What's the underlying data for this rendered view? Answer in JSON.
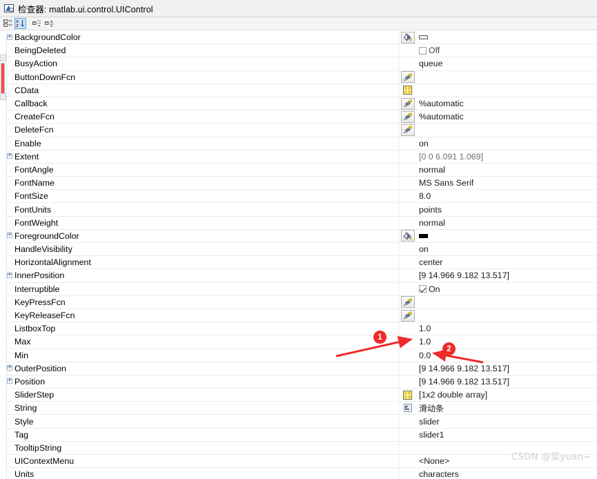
{
  "window": {
    "icon": "inspector-icon",
    "title": "检查器:  matlab.ui.control.UIControl"
  },
  "toolbar": {
    "buttons": [
      {
        "name": "sort-by-category-button",
        "label": "Sort by category",
        "active": false
      },
      {
        "name": "sort-alphabetically-button",
        "label": "Sort alphabetically",
        "active": true
      },
      {
        "name": "expand-all-button",
        "label": "Expand all",
        "active": false
      },
      {
        "name": "collapse-all-button",
        "label": "Collapse all",
        "active": false
      }
    ]
  },
  "grid": {
    "rows": [
      {
        "name": "BackgroundColor",
        "expandable": true,
        "value": "",
        "widget": "color",
        "editor": "paint-bucket",
        "swatch": "#f0f0f0"
      },
      {
        "name": "BeingDeleted",
        "expandable": false,
        "value": "Off",
        "widget": "checkbox",
        "checked": false
      },
      {
        "name": "BusyAction",
        "expandable": false,
        "value": "queue",
        "widget": "text"
      },
      {
        "name": "ButtonDownFcn",
        "expandable": false,
        "value": "",
        "widget": "text",
        "editor": "function-handle"
      },
      {
        "name": "CData",
        "expandable": false,
        "value": "",
        "widget": "text",
        "editor": "array-grid"
      },
      {
        "name": "Callback",
        "expandable": false,
        "value": "%automatic",
        "widget": "text",
        "editor": "function-handle"
      },
      {
        "name": "CreateFcn",
        "expandable": false,
        "value": "%automatic",
        "widget": "text",
        "editor": "function-handle"
      },
      {
        "name": "DeleteFcn",
        "expandable": false,
        "value": "",
        "widget": "text",
        "editor": "function-handle"
      },
      {
        "name": "Enable",
        "expandable": false,
        "value": "on",
        "widget": "text"
      },
      {
        "name": "Extent",
        "expandable": true,
        "value": "[0 0 6.091 1.069]",
        "widget": "text",
        "dim": true
      },
      {
        "name": "FontAngle",
        "expandable": false,
        "value": "normal",
        "widget": "text"
      },
      {
        "name": "FontName",
        "expandable": false,
        "value": "MS Sans Serif",
        "widget": "text"
      },
      {
        "name": "FontSize",
        "expandable": false,
        "value": "8.0",
        "widget": "text"
      },
      {
        "name": "FontUnits",
        "expandable": false,
        "value": "points",
        "widget": "text"
      },
      {
        "name": "FontWeight",
        "expandable": false,
        "value": "normal",
        "widget": "text"
      },
      {
        "name": "ForegroundColor",
        "expandable": true,
        "value": "",
        "widget": "color",
        "editor": "paint-bucket",
        "swatch": "#000000"
      },
      {
        "name": "HandleVisibility",
        "expandable": false,
        "value": "on",
        "widget": "text"
      },
      {
        "name": "HorizontalAlignment",
        "expandable": false,
        "value": "center",
        "widget": "text"
      },
      {
        "name": "InnerPosition",
        "expandable": true,
        "value": "[9 14.966 9.182 13.517]",
        "widget": "text"
      },
      {
        "name": "Interruptible",
        "expandable": false,
        "value": "On",
        "widget": "checkbox",
        "checked": true
      },
      {
        "name": "KeyPressFcn",
        "expandable": false,
        "value": "",
        "widget": "text",
        "editor": "function-handle"
      },
      {
        "name": "KeyReleaseFcn",
        "expandable": false,
        "value": "",
        "widget": "text",
        "editor": "function-handle"
      },
      {
        "name": "ListboxTop",
        "expandable": false,
        "value": "1.0",
        "widget": "text"
      },
      {
        "name": "Max",
        "expandable": false,
        "value": "1.0",
        "widget": "text"
      },
      {
        "name": "Min",
        "expandable": false,
        "value": "0.0",
        "widget": "text"
      },
      {
        "name": "OuterPosition",
        "expandable": true,
        "value": "[9 14.966 9.182 13.517]",
        "widget": "text"
      },
      {
        "name": "Position",
        "expandable": true,
        "value": "[9 14.966 9.182 13.517]",
        "widget": "text"
      },
      {
        "name": "SliderStep",
        "expandable": false,
        "value": "[1x2  double array]",
        "widget": "text",
        "editor": "array-grid"
      },
      {
        "name": "String",
        "expandable": false,
        "value": "滑动条",
        "widget": "text",
        "editor": "string-edit",
        "cjk": true
      },
      {
        "name": "Style",
        "expandable": false,
        "value": "slider",
        "widget": "text"
      },
      {
        "name": "Tag",
        "expandable": false,
        "value": "slider1",
        "widget": "text"
      },
      {
        "name": "TooltipString",
        "expandable": false,
        "value": "",
        "widget": "text"
      },
      {
        "name": "UIContextMenu",
        "expandable": false,
        "value": "<None>",
        "widget": "text"
      },
      {
        "name": "Units",
        "expandable": false,
        "value": "characters",
        "widget": "text"
      }
    ]
  },
  "annotations": {
    "color": "#ee2b2b",
    "markers": [
      {
        "name": "annotation-marker-1",
        "label": "1",
        "target": "Max"
      },
      {
        "name": "annotation-marker-2",
        "label": "2",
        "target": "Min"
      }
    ]
  },
  "watermark": {
    "text": "CSDN @菜yuan~"
  }
}
